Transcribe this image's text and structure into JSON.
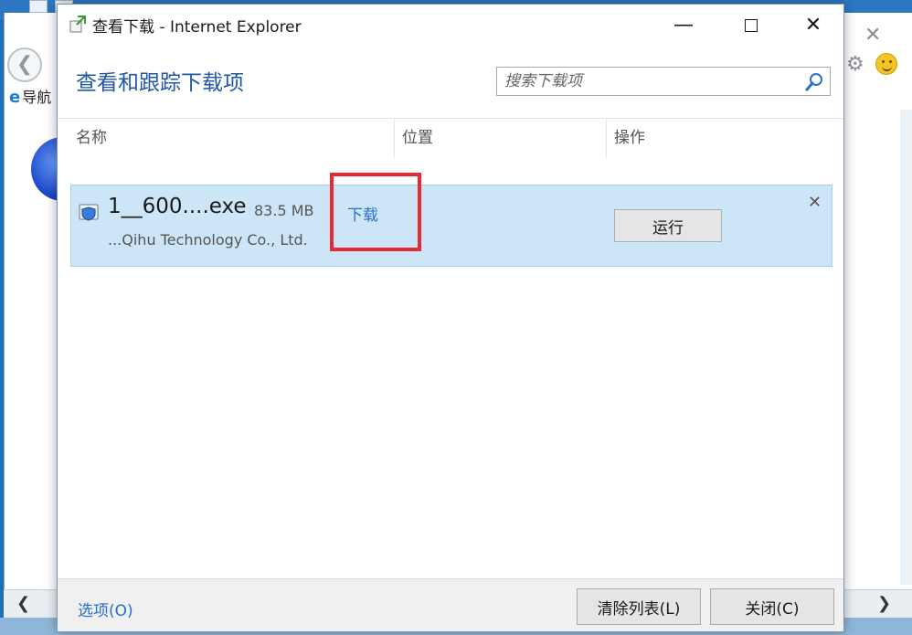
{
  "background_browser": {
    "tab_label": "导航",
    "back_icon": "back-arrow-icon",
    "ie_icon": "internet-explorer-icon",
    "gear_icon": "gear-icon",
    "smiley_icon": "smiley-icon"
  },
  "dialog": {
    "title": "查看下载 - Internet Explorer",
    "heading": "查看和跟踪下载项",
    "search_placeholder": "搜索下载项",
    "columns": {
      "name": "名称",
      "location": "位置",
      "actions": "操作"
    },
    "item": {
      "file_name": "1__600....exe",
      "size": "83.5 MB",
      "publisher": "...Qihu Technology Co., Ltd.",
      "location": "下载",
      "action": "运行"
    },
    "footer": {
      "options": "选项(O)",
      "clear_list": "清除列表(L)",
      "close": "关闭(C)"
    }
  },
  "colors": {
    "heading_blue": "#1f57a3",
    "link_blue": "#2a6fc7",
    "selected_row": "#cde6f7",
    "highlight_red": "#e52b33"
  }
}
